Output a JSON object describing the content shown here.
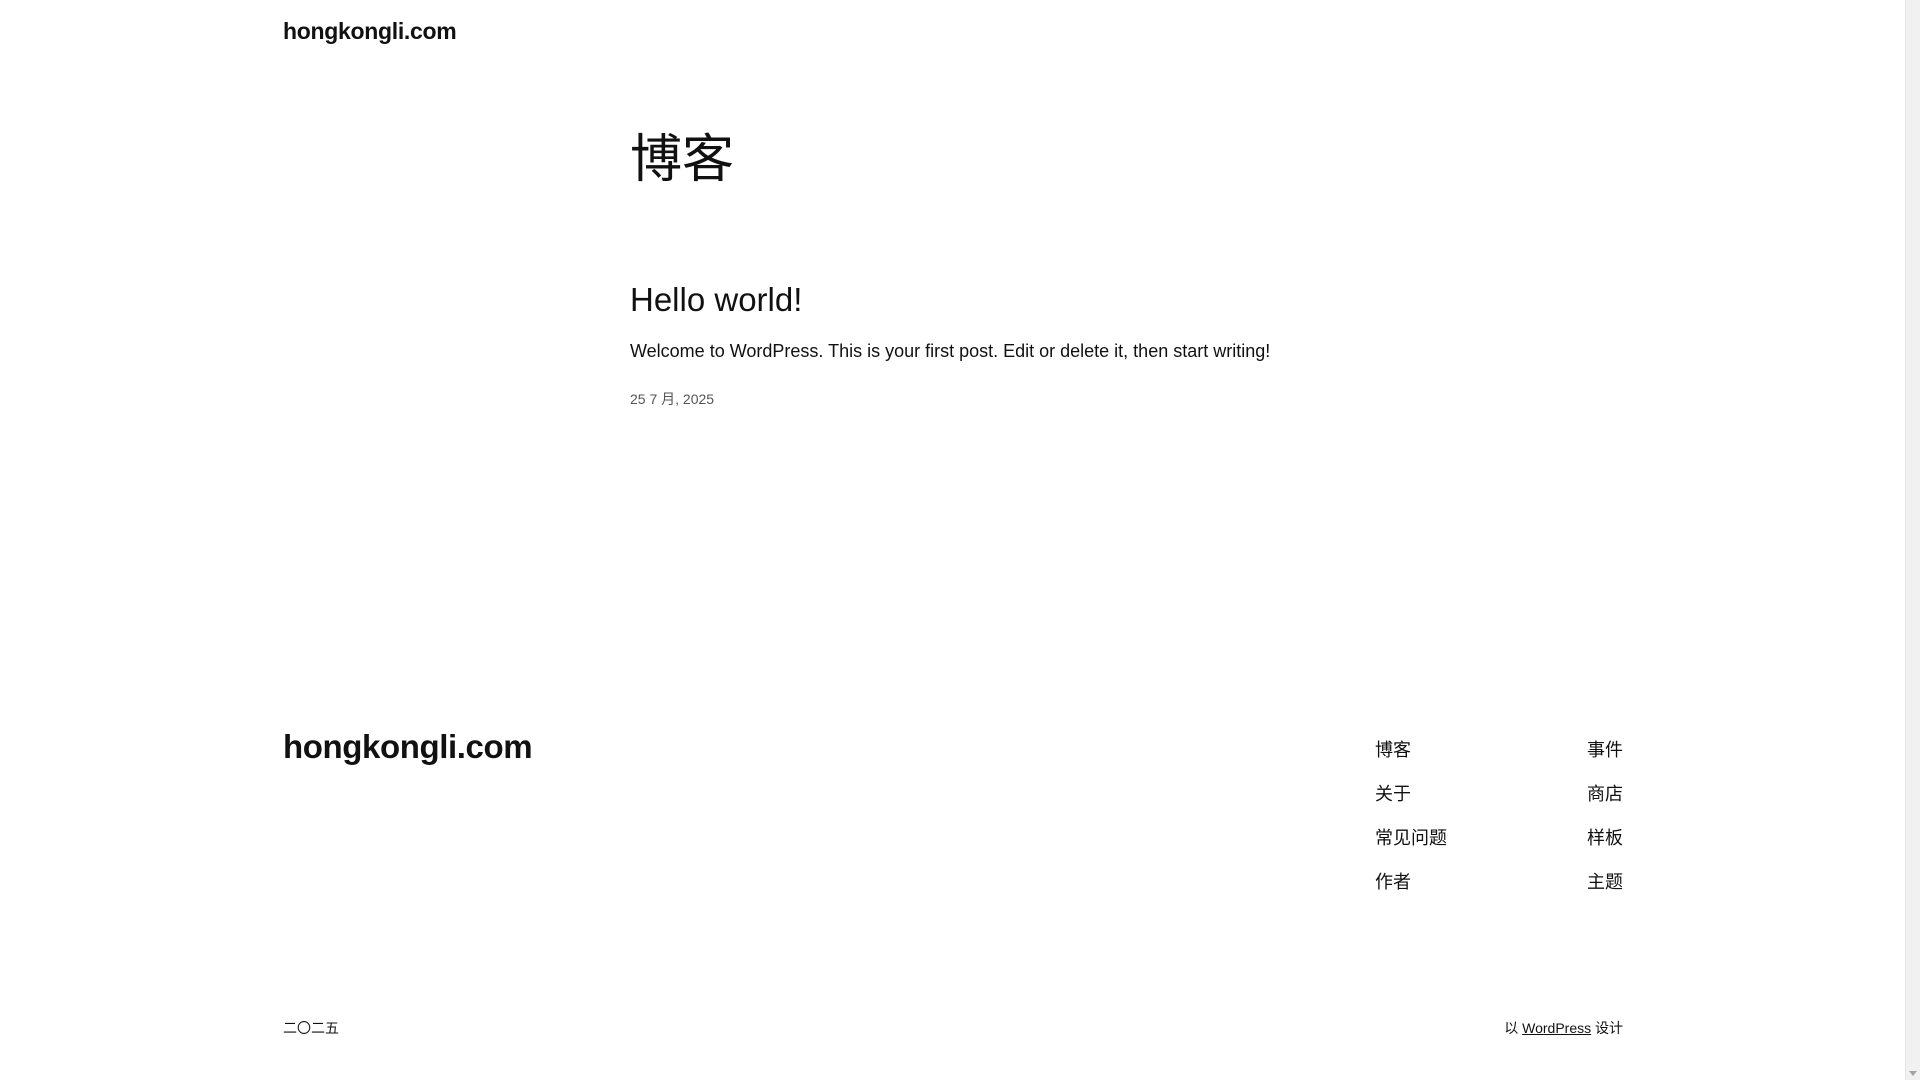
{
  "header": {
    "site_title": "hongkongli.com"
  },
  "archive": {
    "title": "博客"
  },
  "posts": [
    {
      "title": "Hello world!",
      "excerpt": "Welcome to WordPress. This is your first post. Edit or delete it, then start writing!",
      "date": "25 7 月, 2025"
    }
  ],
  "footer": {
    "site_title": "hongkongli.com",
    "nav_col1": [
      "博客",
      "关于",
      "常见问题",
      "作者"
    ],
    "nav_col2": [
      "事件",
      "商店",
      "样板",
      "主题"
    ],
    "copyright": "二〇二五",
    "credit_prefix": "以",
    "credit_link": "WordPress",
    "credit_suffix": "设计"
  },
  "icons": {
    "scroll_down": "chevron-down-icon"
  }
}
